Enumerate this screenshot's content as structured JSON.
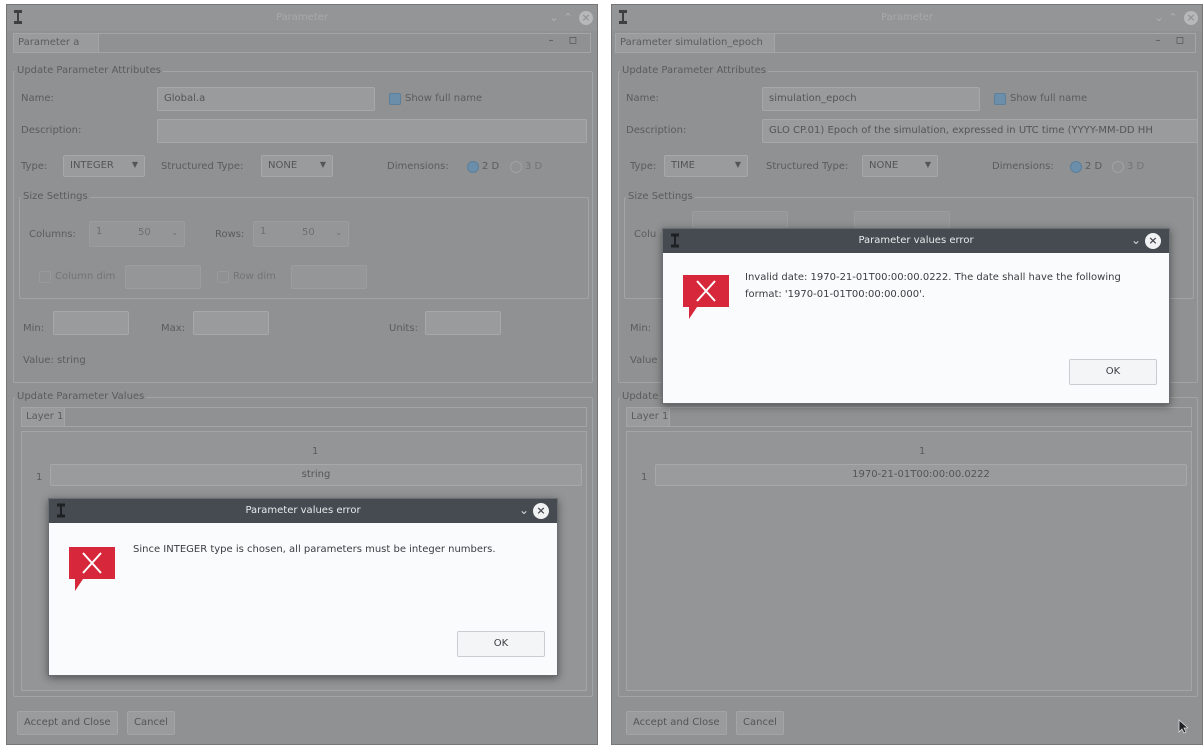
{
  "left": {
    "window_title": "Parameter",
    "dock_tab": "Parameter a",
    "attributes_section": "Update Parameter Attributes",
    "name_label": "Name:",
    "name_value": "Global.a",
    "show_full_name": "Show full name",
    "description_label": "Description:",
    "description_value": "",
    "type_label": "Type:",
    "type_value": "INTEGER",
    "structured_type_label": "Structured Type:",
    "structured_type_value": "NONE",
    "dimensions_label": "Dimensions:",
    "dim_2d": "2 D",
    "dim_3d": "3 D",
    "size_settings": "Size Settings",
    "columns_label": "Columns:",
    "columns_value": "1",
    "rows_label": "Rows:",
    "rows_value": "1",
    "spin_min": "50",
    "column_dim": "Column dim",
    "row_dim": "Row dim",
    "min_label": "Min:",
    "max_label": "Max:",
    "units_label": "Units:",
    "value_label": "Value: string",
    "values_section": "Update Parameter Values",
    "layer_tab": "Layer 1",
    "col_header": "1",
    "row_header": "1",
    "cell_value": "string",
    "accept_button": "Accept and Close",
    "cancel_button": "Cancel",
    "dialog": {
      "title": "Parameter values error",
      "message": "Since INTEGER type is chosen, all parameters must be integer numbers.",
      "ok": "OK"
    }
  },
  "right": {
    "window_title": "Parameter",
    "dock_tab": "Parameter simulation_epoch",
    "attributes_section": "Update Parameter Attributes",
    "name_label": "Name:",
    "name_value": "simulation_epoch",
    "show_full_name": "Show full name",
    "description_label": "Description:",
    "description_value": "GLO CP.01) Epoch of the simulation, expressed in UTC time (YYYY-MM-DD HH",
    "type_label": "Type:",
    "type_value": "TIME",
    "structured_type_label": "Structured Type:",
    "structured_type_value": "NONE",
    "dimensions_label": "Dimensions:",
    "dim_2d": "2 D",
    "dim_3d": "3 D",
    "size_settings": "Size Settings",
    "columns_label": "Colu",
    "min_label": "Min:",
    "value_label": "Value",
    "values_section": "Update",
    "layer_tab": "Layer 1",
    "col_header": "1",
    "row_header": "1",
    "cell_value": "1970-21-01T00:00:00.0222",
    "accept_button": "Accept and Close",
    "cancel_button": "Cancel",
    "dialog": {
      "title": "Parameter values error",
      "message_line1": "Invalid date: 1970-21-01T00:00:00.0222. The date shall have the following",
      "message_line2": "format: '1970-01-01T00:00:00.000'.",
      "ok": "OK"
    }
  },
  "colors": {
    "dialog_titlebar": "#454b51",
    "error_icon": "#d6283a",
    "radio_selected": "#6b8faa"
  },
  "icons": [
    "app-logo-icon",
    "minimize-icon",
    "maximize-icon",
    "close-icon",
    "float-icon",
    "error-icon",
    "chevron-down-icon",
    "mouse-cursor-icon"
  ]
}
